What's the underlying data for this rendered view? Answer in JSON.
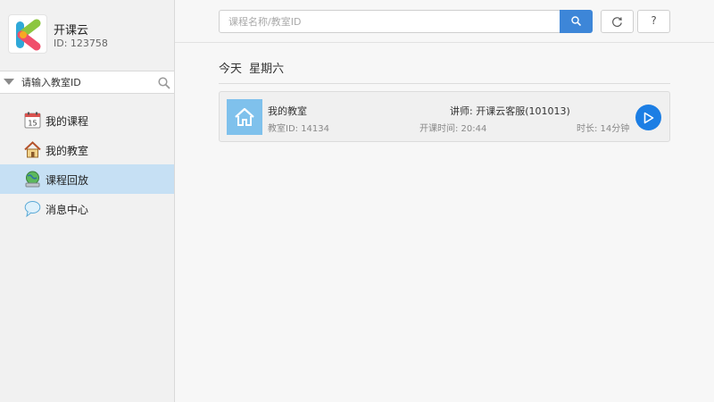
{
  "profile": {
    "app_name": "开课云",
    "user_id": "ID: 123758"
  },
  "class_search": {
    "placeholder": "请输入教室ID"
  },
  "nav": {
    "items": [
      {
        "label": "我的课程",
        "icon": "calendar-icon"
      },
      {
        "label": "我的教室",
        "icon": "house-icon"
      },
      {
        "label": "课程回放",
        "icon": "globe-icon",
        "active": true
      },
      {
        "label": "消息中心",
        "icon": "speech-bubble-icon"
      }
    ]
  },
  "search": {
    "placeholder": "课程名称/教室ID"
  },
  "toolbar": {
    "help_label": "?"
  },
  "day": {
    "title": "今天 星期六"
  },
  "class_card": {
    "name": "我的教室",
    "classroom_id": "教室ID: 14134",
    "teacher": "讲师: 开课云客服(101013)",
    "start_time": "开课时间: 20:44",
    "duration": "时长: 14分钟"
  },
  "colors": {
    "accent": "#3d86d8",
    "active_nav": "#c6e0f4",
    "play": "#1c7ee4",
    "thumb": "#7fc1ec"
  }
}
